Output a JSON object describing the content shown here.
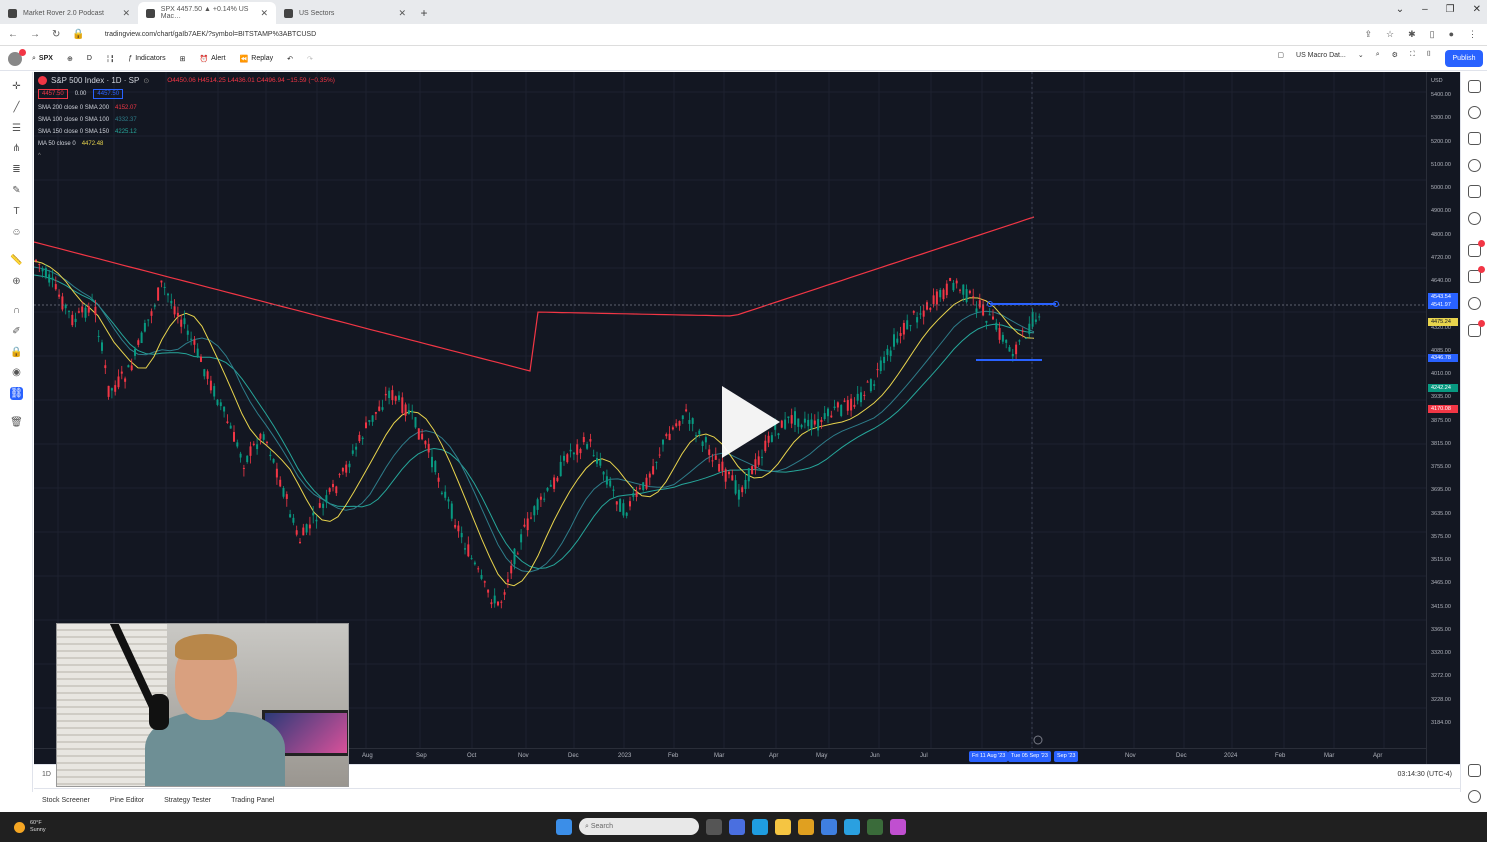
{
  "browser": {
    "tabs": [
      {
        "title": "Market Rover 2.0 Podcast"
      },
      {
        "title": "SPX 4457.50 ▲ +0.14% US Mac…"
      },
      {
        "title": "US Sectors"
      }
    ],
    "url": "tradingview.com/chart/gaIb7AEK/?symbol=BITSTAMP%3ABTCUSD"
  },
  "toolbar": {
    "symbol": "SPX",
    "interval": "D",
    "indicators_label": "Indicators",
    "alert_label": "Alert",
    "replay_label": "Replay",
    "layout_name": "US Macro Dat...",
    "publish_label": "Publish"
  },
  "legend": {
    "title": "S&P 500 Index · 1D · SP",
    "ohlc": "O4450.06 H4514.25 L4436.01 C4496.94 −15.59 (−0.35%)",
    "price_boxes": [
      "4457.50",
      "0.00",
      "4457.50"
    ],
    "indicators": [
      {
        "label": "SMA 200 close 0 SMA 200",
        "value": "4152.07",
        "color": "#f23645"
      },
      {
        "label": "SMA 100 close 0 SMA 100",
        "value": "4332.37",
        "color": "#2e7d8a"
      },
      {
        "label": "SMA 150 close 0 SMA 150",
        "value": "4225.12",
        "color": "#26a69a"
      },
      {
        "label": "MA 50 close 0",
        "value": "4472.48",
        "color": "#e8d44d"
      }
    ]
  },
  "price_axis": {
    "currency": "USD",
    "ticks": [
      "5400.00",
      "5300.00",
      "5200.00",
      "5100.00",
      "5000.00",
      "4900.00",
      "4800.00",
      "4720.00",
      "4640.00",
      "4400.00",
      "4320.00",
      "4085.00",
      "4010.00",
      "3935.00",
      "3875.00",
      "3815.00",
      "3755.00",
      "3695.00",
      "3635.00",
      "3575.00",
      "3515.00",
      "3465.00",
      "3415.00",
      "3365.00",
      "3320.00",
      "3272.00",
      "3228.00",
      "3184.00"
    ],
    "labels": [
      {
        "text": "4543.54",
        "color": "#2962ff"
      },
      {
        "text": "4541.97",
        "color": "#2962ff"
      },
      {
        "text": "4475.24",
        "color": "#e8d44d"
      },
      {
        "text": "4346.78",
        "color": "#2962ff"
      },
      {
        "text": "4242.24",
        "color": "#089981"
      },
      {
        "text": "4170.08",
        "color": "#f23645"
      }
    ]
  },
  "time_axis": {
    "ticks": [
      "Aug",
      "Sep",
      "Oct",
      "Nov",
      "Dec",
      "2023",
      "Feb",
      "Mar",
      "Apr",
      "May",
      "Jun",
      "Jul",
      "Nov",
      "Dec",
      "2024",
      "Feb",
      "Mar",
      "Apr"
    ],
    "highlights": [
      "Fri 11 Aug '23",
      "Tue 05 Sep '23",
      "Sep '23"
    ]
  },
  "bottom": {
    "interval": "1D",
    "clock": "03:14:30 (UTC-4)"
  },
  "panels": [
    "Stock Screener",
    "Pine Editor",
    "Strategy Tester",
    "Trading Panel"
  ],
  "taskbar": {
    "temp": "60°F",
    "weather": "Sunny",
    "search_placeholder": "Search"
  }
}
